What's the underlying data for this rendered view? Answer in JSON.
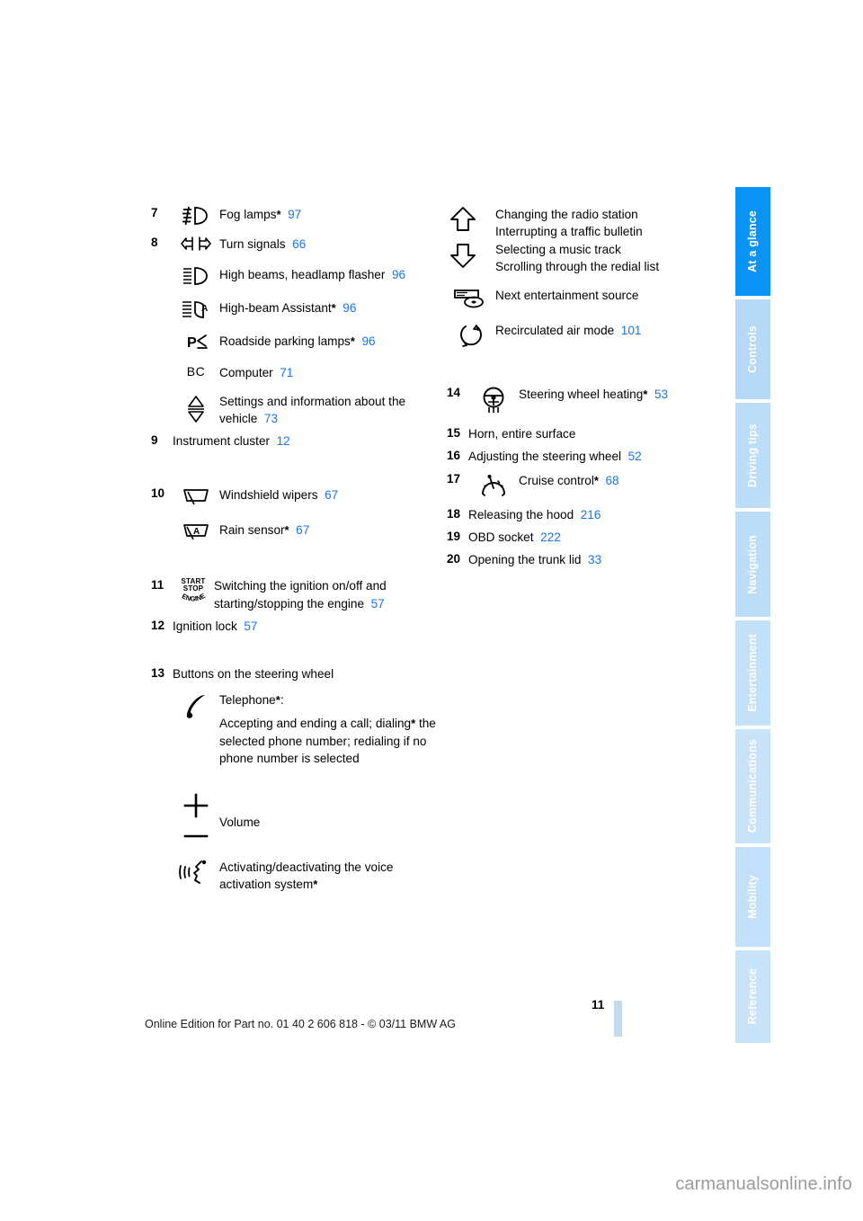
{
  "document": {
    "page_number": "11",
    "footer_note": "Online Edition for Part no. 01 40 2 606 818 - © 03/11 BMW AG",
    "watermark": "carmanualsonline.info"
  },
  "sidebar": {
    "tabs": [
      {
        "label": "At a glance",
        "active": true
      },
      {
        "label": "Controls",
        "active": false
      },
      {
        "label": "Driving tips",
        "active": false
      },
      {
        "label": "Navigation",
        "active": false
      },
      {
        "label": "Entertainment",
        "active": false
      },
      {
        "label": "Communications",
        "active": false
      },
      {
        "label": "Mobility",
        "active": false
      },
      {
        "label": "Reference",
        "active": false
      }
    ],
    "active_color": "#0a93f7",
    "inactive_color": "#bcddf8"
  },
  "left_column": {
    "item7": {
      "number": "7",
      "icon": "fog-lamps-icon",
      "label": "Fog lamps",
      "asterisk": "*",
      "page": "97"
    },
    "item8": {
      "number": "8",
      "entries": [
        {
          "icon": "turn-signals-icon",
          "label": "Turn signals",
          "asterisk": "",
          "page": "66"
        },
        {
          "icon": "high-beams-icon",
          "label": "High beams, headlamp flasher",
          "asterisk": "",
          "page": "96"
        },
        {
          "icon": "high-beam-assistant-icon",
          "label": "High-beam Assistant",
          "asterisk": "*",
          "page": "96"
        },
        {
          "icon": "roadside-parking-lamps-icon",
          "label": "Roadside parking lamps",
          "asterisk": "*",
          "page": "96"
        },
        {
          "icon": "computer-bc-icon",
          "label": "Computer",
          "asterisk": "",
          "page": "71"
        },
        {
          "icon": "settings-updown-icon",
          "label": "Settings and information about the vehicle",
          "asterisk": "",
          "page": "73"
        }
      ]
    },
    "item9": {
      "number": "9",
      "label": "Instrument cluster",
      "page": "12"
    },
    "item10": {
      "number": "10",
      "entries": [
        {
          "icon": "windshield-wipers-icon",
          "label": "Windshield wipers",
          "asterisk": "",
          "page": "67"
        },
        {
          "icon": "rain-sensor-icon",
          "label": "Rain sensor",
          "asterisk": "*",
          "page": "67"
        }
      ]
    },
    "item11": {
      "number": "11",
      "icon": "start-stop-engine-icon",
      "icon_text": {
        "line1": "START",
        "line2": "STOP",
        "line3": "ENGINE"
      },
      "label": "Switching the ignition on/off and starting/stopping the engine",
      "page": "57"
    },
    "item12": {
      "number": "12",
      "label": "Ignition lock",
      "page": "57"
    },
    "item13": {
      "number": "13",
      "label": "Buttons on the steering wheel",
      "entries": [
        {
          "icon": "telephone-icon",
          "title": "Telephone",
          "asterisk": "*",
          "title_suffix": ":",
          "body_pre": "Accepting and ending a call; dialing",
          "body_asterisk": "*",
          "body_post": " the selected phone number; redialing if no phone number is selected"
        },
        {
          "icon": "volume-plus-minus-icon",
          "label": "Volume"
        },
        {
          "icon": "voice-activation-icon",
          "label": "Activating/deactivating the voice activation system",
          "asterisk": "*"
        }
      ]
    }
  },
  "right_column": {
    "arrows_block": {
      "icon_up": "arrow-up-icon",
      "icon_down": "arrow-down-icon",
      "lines": [
        "Changing the radio station",
        "Interrupting a traffic bulletin",
        "Selecting a music track",
        "Scrolling through the redial list"
      ]
    },
    "entertainment_source": {
      "icon": "entertainment-source-icon",
      "label": "Next entertainment source"
    },
    "recirculated_air": {
      "icon": "recirculated-air-icon",
      "label": "Recirculated air mode",
      "page": "101"
    },
    "item14": {
      "number": "14",
      "icon": "steering-wheel-heating-icon",
      "label": "Steering wheel heating",
      "asterisk": "*",
      "page": "53"
    },
    "item15": {
      "number": "15",
      "label": "Horn, entire surface",
      "page": ""
    },
    "item16": {
      "number": "16",
      "label": "Adjusting the steering wheel",
      "page": "52"
    },
    "item17": {
      "number": "17",
      "icon": "cruise-control-icon",
      "label": "Cruise control",
      "asterisk": "*",
      "page": "68"
    },
    "item18": {
      "number": "18",
      "label": "Releasing the hood",
      "page": "216"
    },
    "item19": {
      "number": "19",
      "label": "OBD socket",
      "page": "222"
    },
    "item20": {
      "number": "20",
      "label": "Opening the trunk lid",
      "page": "33"
    }
  }
}
